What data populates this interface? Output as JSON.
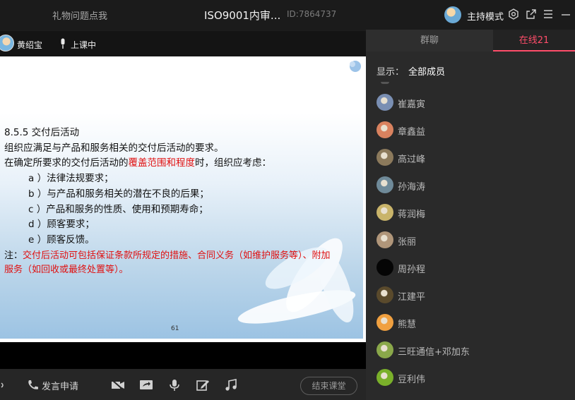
{
  "titlebar": {
    "left_title": "礼物问题点我",
    "main_title": "ISO9001内审...",
    "room_id": "ID:7864737",
    "host_mode": "主持模式",
    "icons": [
      "settings-icon",
      "popout-icon",
      "menu-icon",
      "minimize-icon"
    ]
  },
  "speaker": {
    "name": "黄绍宝",
    "status": "上课中"
  },
  "slide": {
    "heading": "8.5.5  交付后活动",
    "line1": "组织应满足与产品和服务相关的交付后活动的要求。",
    "line2_a": "在确定所要求的交付后活动的",
    "line2_red": "覆盖范围和程度",
    "line2_b": "时，组织应考虑：",
    "items": [
      "a ）法律法规要求；",
      "b ）与产品和服务相关的潜在不良的后果；",
      "c ）产品和服务的性质、使用和预期寿命；",
      "d ）顾客要求；",
      "e ）顾客反馈。"
    ],
    "note_prefix": "注：",
    "note_line1": "交付后活动可包括保证条款所规定的措施、合同义务（如维护服务等）、附加",
    "note_line2": "服务（如回收或最终处置等）。",
    "page_number": "61"
  },
  "toolbar": {
    "speak_label": "发言申请",
    "end_button": "结束课堂"
  },
  "panel": {
    "tab_chat": "群聊",
    "tab_online": "在线21",
    "filter_label": "显示：",
    "filter_value": "全部成员",
    "members": [
      {
        "name": "崔嘉寅",
        "color": "#7a8fb3"
      },
      {
        "name": "章鑫益",
        "color": "#d9825f"
      },
      {
        "name": "高过峰",
        "color": "#8c7a5c"
      },
      {
        "name": "孙海涛",
        "color": "#6f8a99"
      },
      {
        "name": "蒋润梅",
        "color": "#c9b46a"
      },
      {
        "name": "张丽",
        "color": "#b0967a"
      },
      {
        "name": "周孙程",
        "color": "#050505"
      },
      {
        "name": "江建平",
        "color": "#5a4a2c"
      },
      {
        "name": "熊慧",
        "color": "#f0a040"
      },
      {
        "name": "三旺通信+邓加东",
        "color": "#8aa84a"
      },
      {
        "name": "豆利伟",
        "color": "#7ab02a"
      }
    ]
  }
}
